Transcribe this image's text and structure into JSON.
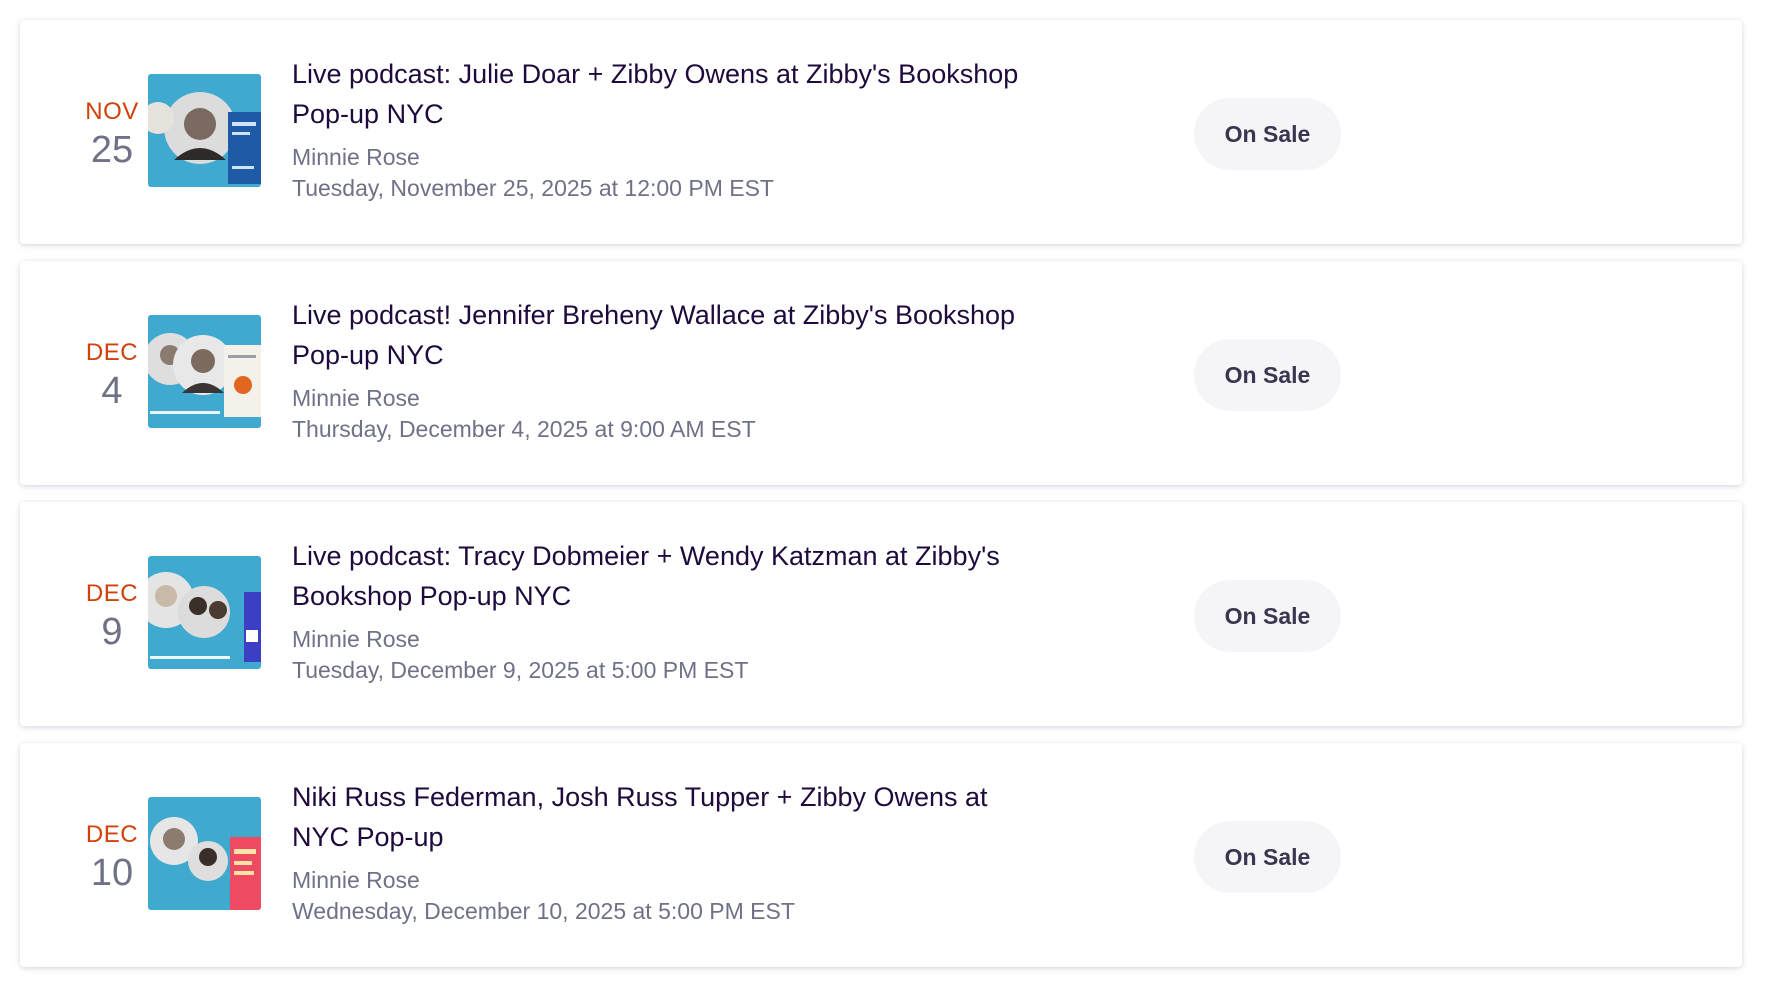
{
  "colors": {
    "month_accent": "#d1410c",
    "day_gray": "#6f7287",
    "title_navy": "#1e0a3c",
    "meta_gray": "#6f7287",
    "pill_bg": "#f5f5f7",
    "pill_text": "#39364f",
    "thumb_blue": "#3fa9cf"
  },
  "events": [
    {
      "month": "NOV",
      "day": "25",
      "title": "Live podcast: Julie Doar + Zibby Owens at Zibby's Bookshop Pop-up NYC",
      "organizer": "Minnie Rose",
      "datetime": "Tuesday, November 25, 2025 at 12:00 PM EST",
      "status": "On Sale",
      "thumbnail_icon": "event-cover-image-icon"
    },
    {
      "month": "DEC",
      "day": "4",
      "title": "Live podcast! Jennifer Breheny Wallace at Zibby's Bookshop Pop-up NYC",
      "organizer": "Minnie Rose",
      "datetime": "Thursday, December 4, 2025 at 9:00 AM EST",
      "status": "On Sale",
      "thumbnail_icon": "event-cover-image-icon"
    },
    {
      "month": "DEC",
      "day": "9",
      "title": "Live podcast: Tracy Dobmeier + Wendy Katzman at Zibby's Bookshop Pop-up NYC",
      "organizer": "Minnie Rose",
      "datetime": "Tuesday, December 9, 2025 at 5:00 PM EST",
      "status": "On Sale",
      "thumbnail_icon": "event-cover-image-icon"
    },
    {
      "month": "DEC",
      "day": "10",
      "title": "Niki Russ Federman, Josh Russ Tupper + Zibby Owens at NYC Pop-up",
      "organizer": "Minnie Rose",
      "datetime": "Wednesday, December 10, 2025 at 5:00 PM EST",
      "status": "On Sale",
      "thumbnail_icon": "event-cover-image-icon"
    }
  ]
}
